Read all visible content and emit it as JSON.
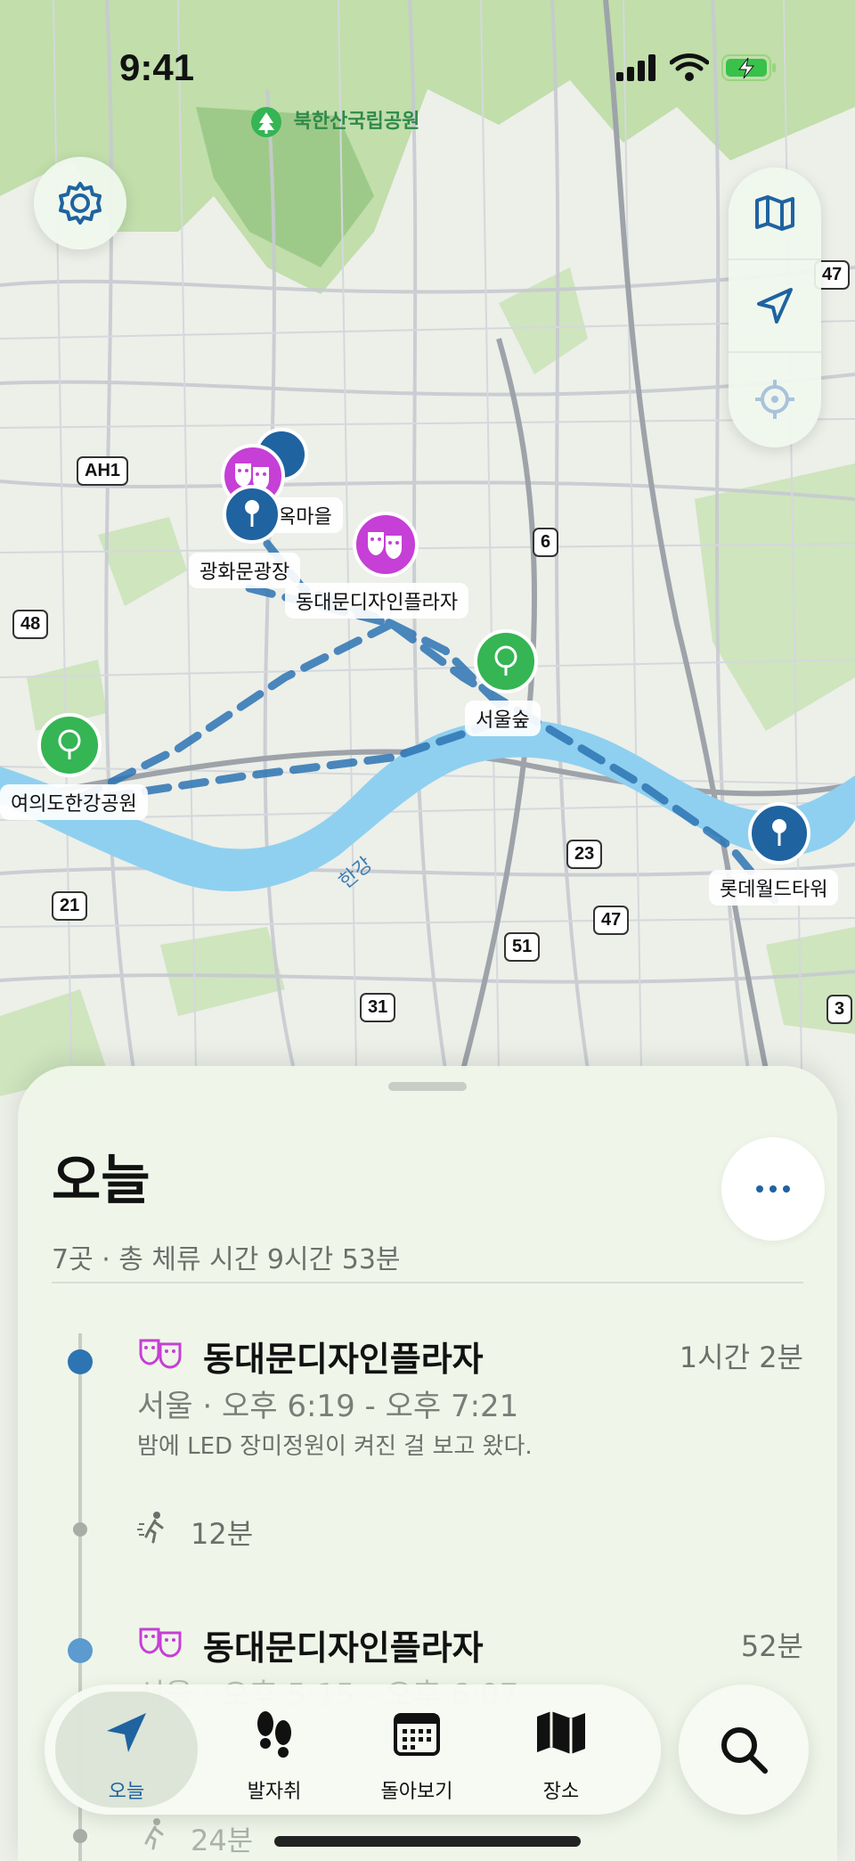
{
  "status_bar": {
    "time": "9:41"
  },
  "map": {
    "park_label": "북한산국립공원",
    "river_label": "한강",
    "pins": [
      {
        "label": "동대문디자인플라자",
        "type": "theater"
      },
      {
        "label": "서울숲",
        "type": "park"
      },
      {
        "label": "여의도한강공원",
        "type": "park"
      },
      {
        "label": "광화문광장",
        "type": "landmark"
      },
      {
        "label": "북촌한옥마을",
        "visible_label": "옥마을",
        "type": "landmark"
      },
      {
        "label": "롯데월드타워",
        "type": "landmark"
      }
    ],
    "road_badges": [
      "AH1",
      "6",
      "48",
      "47",
      "23",
      "47",
      "51",
      "21",
      "31",
      "3"
    ],
    "controls": [
      "map-icon",
      "location-arrow-icon",
      "crosshair-icon"
    ]
  },
  "sheet": {
    "title": "오늘",
    "summary": "7곳 · 총 체류 시간 9시간 53분",
    "visits": [
      {
        "name": "동대문디자인플라자",
        "duration": "1시간 2분",
        "meta": "서울 · 오후 6:19 - 오후 7:21",
        "note": "밤에 LED 장미정원이 켜진 걸 보고 왔다."
      },
      {
        "name": "동대문디자인플라자",
        "duration": "52분",
        "meta": "서울 · 오후 5:15 - 오후 6:07"
      }
    ],
    "travels": [
      {
        "mode": "walking",
        "time": "12분"
      },
      {
        "mode": "walking",
        "time": "24분"
      }
    ]
  },
  "tabbar": {
    "tabs": [
      {
        "label": "오늘",
        "icon": "location-arrow-icon",
        "active": true
      },
      {
        "label": "발자취",
        "icon": "footprints-icon",
        "active": false
      },
      {
        "label": "돌아보기",
        "icon": "calendar-icon",
        "active": false
      },
      {
        "label": "장소",
        "icon": "map-icon",
        "active": false
      }
    ],
    "search_icon": "search-icon"
  },
  "colors": {
    "accent": "#1f63a0",
    "theater_pin": "#c63fd6",
    "park_pin": "#35b553",
    "landmark_pin": "#1f63a0",
    "river": "#8fd0f0",
    "route": "#2d74b3"
  }
}
